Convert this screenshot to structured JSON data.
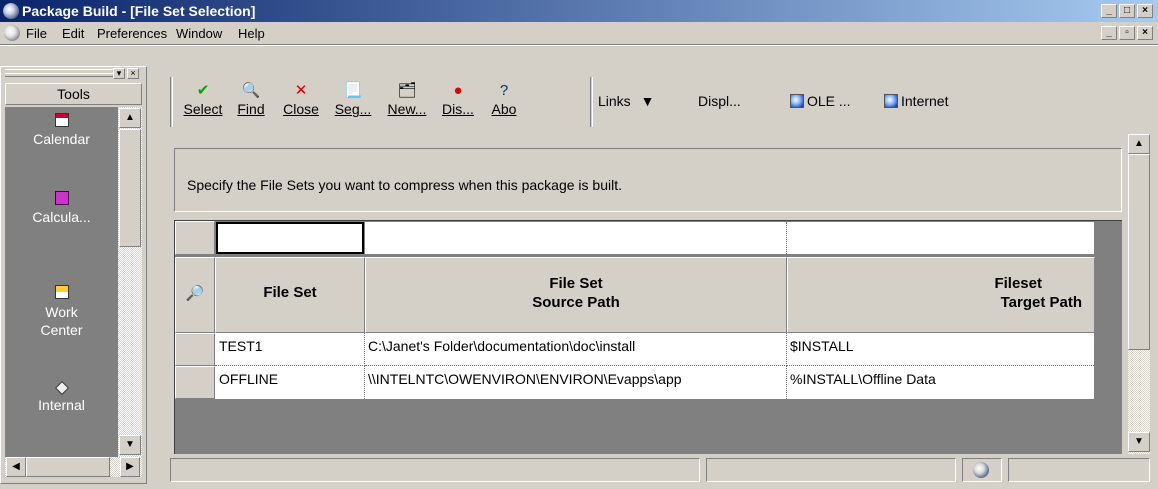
{
  "window": {
    "title": "Package Build - [File Set Selection]",
    "controls": {
      "minimize": "_",
      "maximize": "□",
      "close": "×",
      "restore": "▫"
    }
  },
  "menu": {
    "items": [
      "File",
      "Edit",
      "Preferences",
      "Window",
      "Help"
    ]
  },
  "tools_pane": {
    "header": "Tools",
    "items": [
      {
        "label": "Calendar",
        "icon": "calendar-icon"
      },
      {
        "label": "Calcula...",
        "icon": "calculator-icon"
      },
      {
        "label": "Work Center",
        "label_line1": "Work",
        "label_line2": "Center",
        "icon": "work-center-icon"
      },
      {
        "label": "Internal",
        "icon": "internal-icon"
      }
    ]
  },
  "toolbar": {
    "buttons": [
      {
        "label": "Select",
        "icon": "check-icon"
      },
      {
        "label": "Find",
        "icon": "find-icon"
      },
      {
        "label": "Close",
        "icon": "close-x-icon"
      },
      {
        "label": "Seg...",
        "icon": "segment-icon"
      },
      {
        "label": "New...",
        "icon": "new-icon"
      },
      {
        "label": "Dis...",
        "icon": "display-icon"
      },
      {
        "label": "Abo",
        "icon": "about-icon"
      }
    ],
    "links_label": "Links",
    "display_label": "Displ...",
    "ole_label": "OLE ...",
    "internet_label": "Internet"
  },
  "form": {
    "instruction": "Specify the File Sets you want to compress when this package is built.",
    "grid": {
      "columns": [
        {
          "line1": "File Set",
          "line2": ""
        },
        {
          "line1": "File Set",
          "line2": "Source Path"
        },
        {
          "line1": "Fileset",
          "line2": "Target Path"
        }
      ],
      "rows": [
        {
          "file_set": "TEST1",
          "source_path": "C:\\Janet's Folder\\documentation\\doc\\install",
          "target_path": "$INSTALL"
        },
        {
          "file_set": "OFFLINE",
          "source_path": "\\\\INTELNTC\\OWENVIRON\\ENVIRON\\Evapps\\app",
          "target_path": "%INSTALL\\Offline Data"
        }
      ]
    }
  },
  "colors": {
    "title_start": "#0a246a",
    "title_end": "#a6caf0",
    "face": "#d4d0c8",
    "grid_empty": "#808080"
  }
}
